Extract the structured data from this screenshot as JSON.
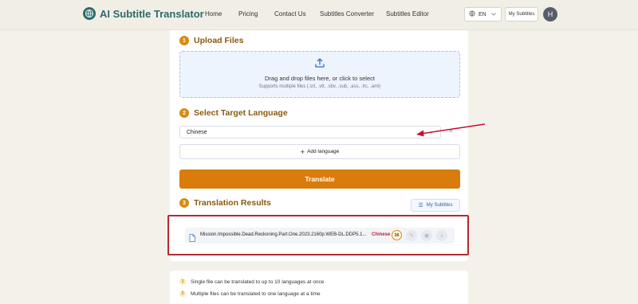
{
  "header": {
    "brand": "AI Subtitle Translator",
    "nav": [
      "Home",
      "Pricing",
      "Contact Us",
      "Subtitles Converter",
      "Subtitles Editor"
    ],
    "language": "EN",
    "my_subtitles": "My Subtitles",
    "avatar_initial": "H"
  },
  "upload": {
    "step": "1",
    "title": "Upload Files",
    "drop_text": "Drag and drop files here, or click to select",
    "supports": "Supports multiple files (.srt, .vtt, .sbv, .sub, .ass, .lrc, .aml)"
  },
  "target": {
    "step": "2",
    "title": "Select Target Language",
    "selected": "Chinese",
    "add_language": "Add language"
  },
  "translate_button": "Translate",
  "results": {
    "step": "3",
    "title": "Translation Results",
    "my_subtitles": "My Subtitles",
    "file": {
      "name": "Mission.Impossible.Dead.Reckoning.Part.One.2023.2160p.WEB-DL.DDP5.1...",
      "language": "Chinese",
      "badge": "36"
    }
  },
  "notes": [
    {
      "num": "1",
      "text": "Single file can be translated to up to 10 languages at once"
    },
    {
      "num": "2",
      "text": "Multiple files can be translated to one language at a time"
    }
  ],
  "colors": {
    "brand": "#2d6b6a",
    "accent": "#d97c0b",
    "step_title": "#8a5a10",
    "highlight": "#b52a33"
  }
}
